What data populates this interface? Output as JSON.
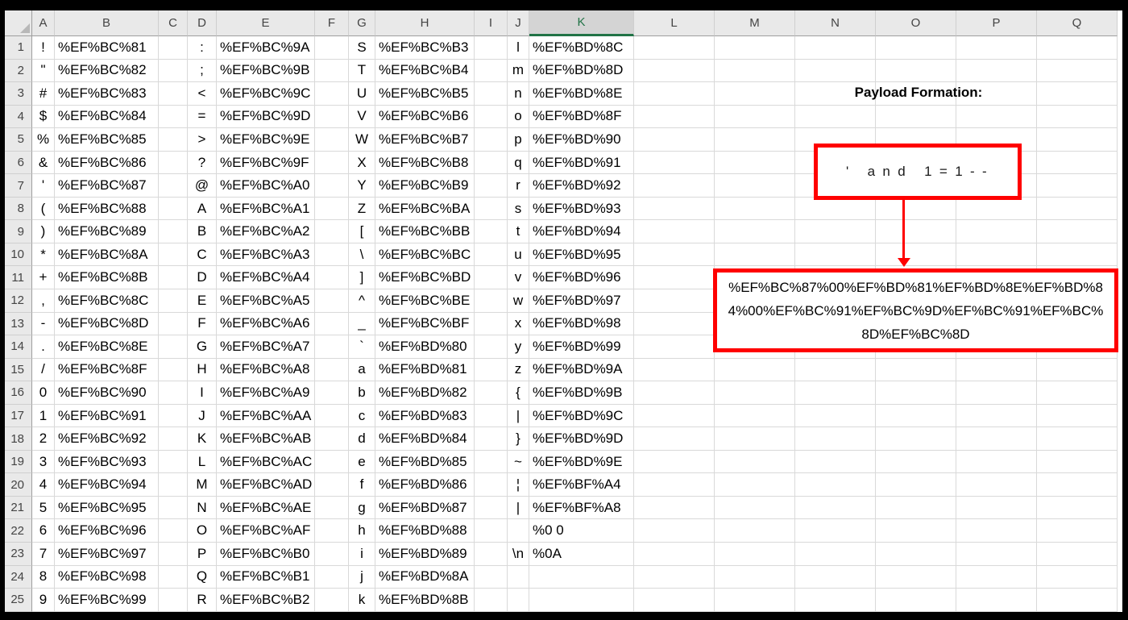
{
  "sheet": {
    "selected_column": "K",
    "columns": [
      "A",
      "B",
      "C",
      "D",
      "E",
      "F",
      "G",
      "H",
      "I",
      "J",
      "K",
      "L",
      "M",
      "N",
      "O",
      "P",
      "Q"
    ],
    "row_numbers": [
      1,
      2,
      3,
      4,
      5,
      6,
      7,
      8,
      9,
      10,
      11,
      12,
      13,
      14,
      15,
      16,
      17,
      18,
      19,
      20,
      21,
      22,
      23,
      24,
      25
    ],
    "row_cell_columns": [
      "A",
      "B",
      "D",
      "E",
      "G",
      "H",
      "J",
      "K"
    ],
    "rows": [
      [
        "!",
        "%EF%BC%81",
        ":",
        "%EF%BC%9A",
        "S",
        "%EF%BC%B3",
        "l",
        "%EF%BD%8C"
      ],
      [
        "\"",
        "%EF%BC%82",
        ";",
        "%EF%BC%9B",
        "T",
        "%EF%BC%B4",
        "m",
        "%EF%BD%8D"
      ],
      [
        "#",
        "%EF%BC%83",
        "<",
        "%EF%BC%9C",
        "U",
        "%EF%BC%B5",
        "n",
        "%EF%BD%8E"
      ],
      [
        "$",
        "%EF%BC%84",
        "=",
        "%EF%BC%9D",
        "V",
        "%EF%BC%B6",
        "o",
        "%EF%BD%8F"
      ],
      [
        "%",
        "%EF%BC%85",
        ">",
        "%EF%BC%9E",
        "W",
        "%EF%BC%B7",
        "p",
        "%EF%BD%90"
      ],
      [
        "&",
        "%EF%BC%86",
        "?",
        "%EF%BC%9F",
        "X",
        "%EF%BC%B8",
        "q",
        "%EF%BD%91"
      ],
      [
        "'",
        "%EF%BC%87",
        "@",
        "%EF%BC%A0",
        "Y",
        "%EF%BC%B9",
        "r",
        "%EF%BD%92"
      ],
      [
        "(",
        "%EF%BC%88",
        "A",
        "%EF%BC%A1",
        "Z",
        "%EF%BC%BA",
        "s",
        "%EF%BD%93"
      ],
      [
        ")",
        "%EF%BC%89",
        "B",
        "%EF%BC%A2",
        "[",
        "%EF%BC%BB",
        "t",
        "%EF%BD%94"
      ],
      [
        "*",
        "%EF%BC%8A",
        "C",
        "%EF%BC%A3",
        "\\",
        "%EF%BC%BC",
        "u",
        "%EF%BD%95"
      ],
      [
        "+",
        "%EF%BC%8B",
        "D",
        "%EF%BC%A4",
        "]",
        "%EF%BC%BD",
        "v",
        "%EF%BD%96"
      ],
      [
        ",",
        "%EF%BC%8C",
        "E",
        "%EF%BC%A5",
        "^",
        "%EF%BC%BE",
        "w",
        "%EF%BD%97"
      ],
      [
        "-",
        "%EF%BC%8D",
        "F",
        "%EF%BC%A6",
        "_",
        "%EF%BC%BF",
        "x",
        "%EF%BD%98"
      ],
      [
        ".",
        "%EF%BC%8E",
        "G",
        "%EF%BC%A7",
        "`",
        "%EF%BD%80",
        "y",
        "%EF%BD%99"
      ],
      [
        "/",
        "%EF%BC%8F",
        "H",
        "%EF%BC%A8",
        "a",
        "%EF%BD%81",
        "z",
        "%EF%BD%9A"
      ],
      [
        "0",
        "%EF%BC%90",
        "I",
        "%EF%BC%A9",
        "b",
        "%EF%BD%82",
        "{",
        "%EF%BD%9B"
      ],
      [
        "1",
        "%EF%BC%91",
        "J",
        "%EF%BC%AA",
        "c",
        "%EF%BD%83",
        "|",
        "%EF%BD%9C"
      ],
      [
        "2",
        "%EF%BC%92",
        "K",
        "%EF%BC%AB",
        "d",
        "%EF%BD%84",
        "}",
        "%EF%BD%9D"
      ],
      [
        "3",
        "%EF%BC%93",
        "L",
        "%EF%BC%AC",
        "e",
        "%EF%BD%85",
        "~",
        "%EF%BD%9E"
      ],
      [
        "4",
        "%EF%BC%94",
        "M",
        "%EF%BC%AD",
        "f",
        "%EF%BD%86",
        "¦",
        "%EF%BF%A4"
      ],
      [
        "5",
        "%EF%BC%95",
        "N",
        "%EF%BC%AE",
        "g",
        "%EF%BD%87",
        "|",
        "%EF%BF%A8"
      ],
      [
        "6",
        "%EF%BC%96",
        "O",
        "%EF%BC%AF",
        "h",
        "%EF%BD%88",
        "",
        "%0 0"
      ],
      [
        "7",
        "%EF%BC%97",
        "P",
        "%EF%BC%B0",
        "i",
        "%EF%BD%89",
        "\\n",
        "%0A"
      ],
      [
        "8",
        "%EF%BC%98",
        "Q",
        "%EF%BC%B1",
        "j",
        "%EF%BD%8A",
        "",
        ""
      ],
      [
        "9",
        "%EF%BC%99",
        "R",
        "%EF%BC%B2",
        "k",
        "%EF%BD%8B",
        "",
        ""
      ]
    ]
  },
  "annotation": {
    "title": "Payload Formation:",
    "decoded_payload": "' and 1=1--",
    "encoded_payload": "%EF%BC%87%00%EF%BD%81%EF%BD%8E%EF%BD%84%00%EF%BC%91%EF%BC%9D%EF%BC%91%EF%BC%8D%EF%BC%8D",
    "encoded_payload_display": "%EF%BC%87%00%EF%BD%81%EF%BD%8E%EF%BD%8\n4%00%EF%BC%91%EF%BC%9D%EF%BC%91%EF%BC%\n8D%EF%BC%8D"
  },
  "colors": {
    "box_red": "#ff0000",
    "arrow_red": "#ff0000",
    "selected_header_green": "#217346",
    "header_bg": "#e9e9e9",
    "selected_header_bg": "#d4d4d4",
    "gridline": "#d9d9d9",
    "frame": "#000000"
  }
}
